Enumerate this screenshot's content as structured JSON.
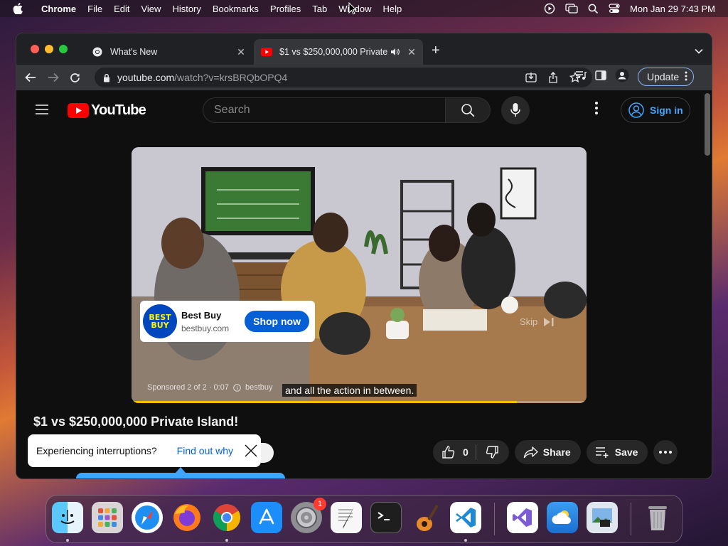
{
  "menubar": {
    "app_name": "Chrome",
    "items": [
      "File",
      "Edit",
      "View",
      "History",
      "Bookmarks",
      "Profiles",
      "Tab",
      "Window",
      "Help"
    ],
    "clock": "Mon Jan 29  7:43 PM"
  },
  "browser": {
    "tabs": [
      {
        "title": "What's New",
        "icon": "chrome-icon"
      },
      {
        "title": "$1 vs $250,000,000 Private Island!",
        "icon": "youtube-icon",
        "audio": true
      }
    ],
    "url_host": "youtube.com",
    "url_path": "/watch?v=krsBRQbOPQ4",
    "update_label": "Update"
  },
  "youtube": {
    "logo_text": "YouTube",
    "search_placeholder": "Search",
    "sign_in_label": "Sign in",
    "video_title": "$1 vs $250,000,000 Private Island!",
    "like_count": "0",
    "share_label": "Share",
    "save_label": "Save"
  },
  "ad": {
    "logo_text_top": "BEST",
    "logo_text_bottom": "BUY",
    "advertiser": "Best Buy",
    "domain": "bestbuy.com",
    "cta_label": "Shop now",
    "skip_label": "Skip",
    "sponsored_text": "Sponsored 2 of 2 · 0:07",
    "sponsor_short": "bestbuy",
    "caption": "and all the action in between.",
    "progress_fraction": 0.847
  },
  "interrupt_prompt": {
    "text": "Experiencing interruptions?",
    "link": "Find out why"
  },
  "dock": {
    "apps": [
      "finder",
      "launchpad",
      "safari",
      "firefox",
      "chrome",
      "app-store",
      "system-settings",
      "textedit",
      "terminal",
      "garageband",
      "vscode",
      "visual-studio",
      "weather",
      "preview",
      "trash"
    ],
    "settings_badge": "1"
  },
  "colors": {
    "youtube_red": "#ff0000",
    "link_blue": "#3ea6ff",
    "bestbuy_blue": "#0046be",
    "bestbuy_yellow": "#fff200",
    "ad_progress": "#f2c200"
  }
}
